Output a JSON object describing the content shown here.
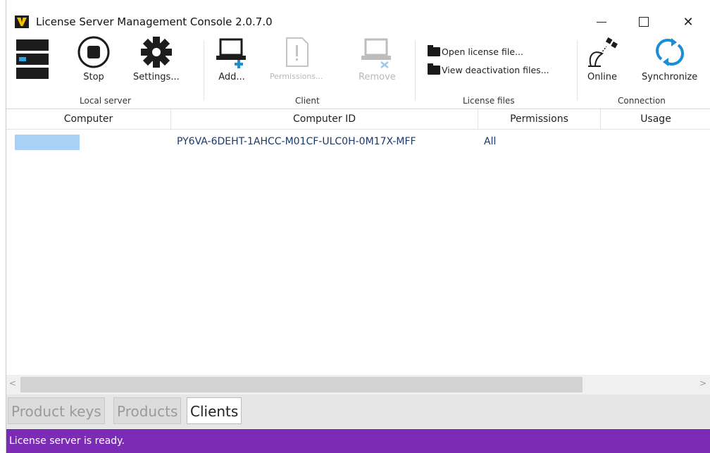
{
  "window": {
    "title": "License Server Management Console 2.0.7.0"
  },
  "ribbon": {
    "local_server": {
      "group_label": "Local server",
      "stop_label": "Stop",
      "settings_label": "Settings..."
    },
    "client": {
      "group_label": "Client",
      "add_label": "Add...",
      "permissions_label": "Permissions...",
      "remove_label": "Remove"
    },
    "license_files": {
      "group_label": "License files",
      "open_label": "Open license file...",
      "view_deactivation_label": "View deactivation files..."
    },
    "connection": {
      "group_label": "Connection",
      "online_label": "Online",
      "synchronize_label": "Synchronize"
    }
  },
  "table": {
    "columns": [
      "Computer",
      "Computer ID",
      "Permissions",
      "Usage"
    ],
    "rows": [
      {
        "computer": "",
        "computer_id": "PY6VA-6DEHT-1AHCC-M01CF-ULC0H-0M17X-MFF",
        "permissions": "All",
        "usage": ""
      }
    ]
  },
  "tabs": [
    {
      "label": "Product keys",
      "active": false
    },
    {
      "label": "Products",
      "active": false
    },
    {
      "label": "Clients",
      "active": true
    }
  ],
  "status": {
    "text": "License server is ready.",
    "color": "#7b2bb5"
  },
  "colors": {
    "accent_plus": "#1a8fd6",
    "sync_blue": "#1a8fd6",
    "selection": "#a9d0f5"
  }
}
